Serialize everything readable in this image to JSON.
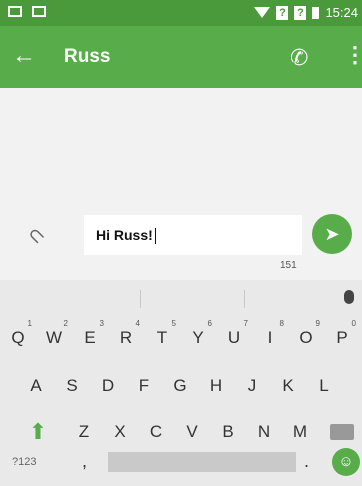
{
  "status_bar": {
    "time": "15:24",
    "signal_text": "?"
  },
  "toolbar": {
    "title": "Russ",
    "back_icon": "arrow-left-icon",
    "call_icon": "phone-icon",
    "menu_icon": "more-vert-icon"
  },
  "compose": {
    "input_value": "Hi Russ!",
    "char_counter": "151",
    "attach_icon": "paperclip-icon",
    "send_icon": "send-icon"
  },
  "keyboard": {
    "row1": [
      "Q",
      "W",
      "E",
      "R",
      "T",
      "Y",
      "U",
      "I",
      "O",
      "P"
    ],
    "row1_hints": [
      "1",
      "2",
      "3",
      "4",
      "5",
      "6",
      "7",
      "8",
      "9",
      "0"
    ],
    "row2": [
      "A",
      "S",
      "D",
      "F",
      "G",
      "H",
      "J",
      "K",
      "L"
    ],
    "row3": [
      "Z",
      "X",
      "C",
      "V",
      "B",
      "N",
      "M"
    ],
    "symbols_label": "?123",
    "comma": ",",
    "period": "."
  },
  "colors": {
    "accent": "#58ad4a",
    "status_bar": "#4a9a3c"
  }
}
